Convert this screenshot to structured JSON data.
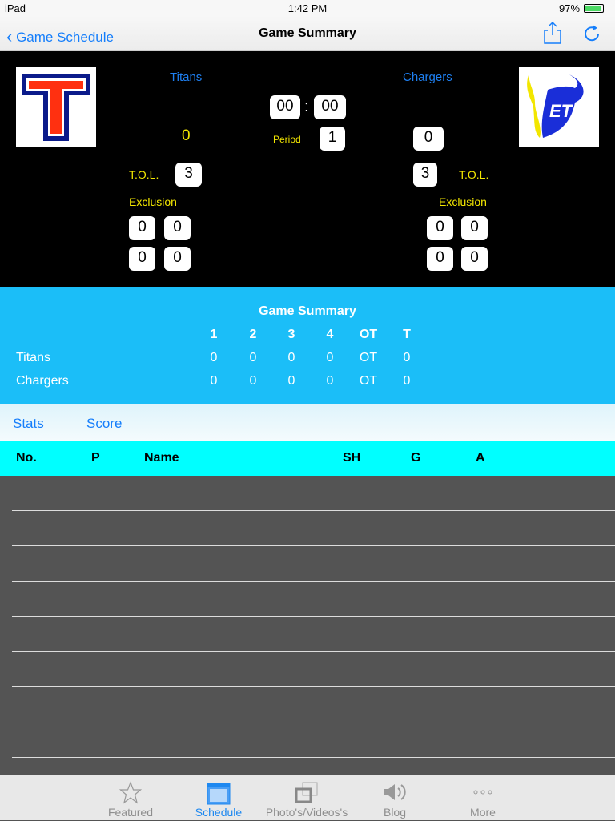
{
  "status": {
    "device": "iPad",
    "time": "1:42 PM",
    "battery": "97%"
  },
  "nav": {
    "back": "Game Schedule",
    "title": "Game Summary"
  },
  "board": {
    "home": {
      "name": "Titans",
      "score": "0",
      "tol": "3",
      "exclusions": [
        "0",
        "0",
        "0",
        "0"
      ]
    },
    "away": {
      "name": "Chargers",
      "score": "0",
      "tol": "3",
      "exclusions": [
        "0",
        "0",
        "0",
        "0"
      ]
    },
    "clock_min": "00",
    "clock_sec": "00",
    "colon": ":",
    "period_label": "Period",
    "period": "1",
    "tol_label": "T.O.L.",
    "exclusion_label": "Exclusion"
  },
  "summary": {
    "title": "Game Summary",
    "headers": [
      "1",
      "2",
      "3",
      "4",
      "OT",
      "T"
    ],
    "rows": [
      {
        "team": "Titans",
        "values": [
          "0",
          "0",
          "0",
          "0",
          "OT",
          "0"
        ]
      },
      {
        "team": "Chargers",
        "values": [
          "0",
          "0",
          "0",
          "0",
          "OT",
          "0"
        ]
      }
    ]
  },
  "tabs": {
    "stats": "Stats",
    "score": "Score"
  },
  "table": {
    "headers": [
      "No.",
      "P",
      "Name",
      "SH",
      "G",
      "A"
    ]
  },
  "tabbar": [
    {
      "label": "Featured",
      "icon": "star-icon"
    },
    {
      "label": "Schedule",
      "icon": "calendar-icon",
      "active": true
    },
    {
      "label": "Photo's/Videos's",
      "icon": "photos-icon"
    },
    {
      "label": "Blog",
      "icon": "speaker-icon"
    },
    {
      "label": "More",
      "icon": "more-icon"
    }
  ],
  "colors": {
    "accent": "#157efb",
    "summary_bg": "#1bbef8",
    "header_bg": "#00ffff",
    "yellow": "#f2e600"
  }
}
